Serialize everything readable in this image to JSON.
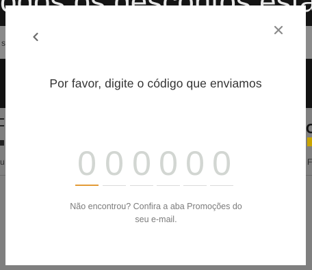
{
  "background": {
    "banner_text": "odos os descontos estão aqui",
    "subbar_text": "s",
    "left_text": "u",
    "right_logo": "C",
    "right_text": "F"
  },
  "modal": {
    "title": "Por favor, digite o código que enviamos",
    "code_digits": [
      "0",
      "0",
      "0",
      "0",
      "0",
      "0"
    ],
    "active_digit_index": 0,
    "hint_line1": "Não encontrou? Confira a aba Promoções do",
    "hint_line2": "seu e-mail.",
    "back_icon": "chevron-left-icon",
    "close_icon": "close-icon"
  },
  "colors": {
    "overlay_bg": "#7a7a7a",
    "modal_bg": "#ffffff",
    "accent_active_underline": "#e39a36",
    "digit_placeholder": "#d2d6d2",
    "text_primary": "#333333",
    "text_muted": "#7b7b7b"
  }
}
